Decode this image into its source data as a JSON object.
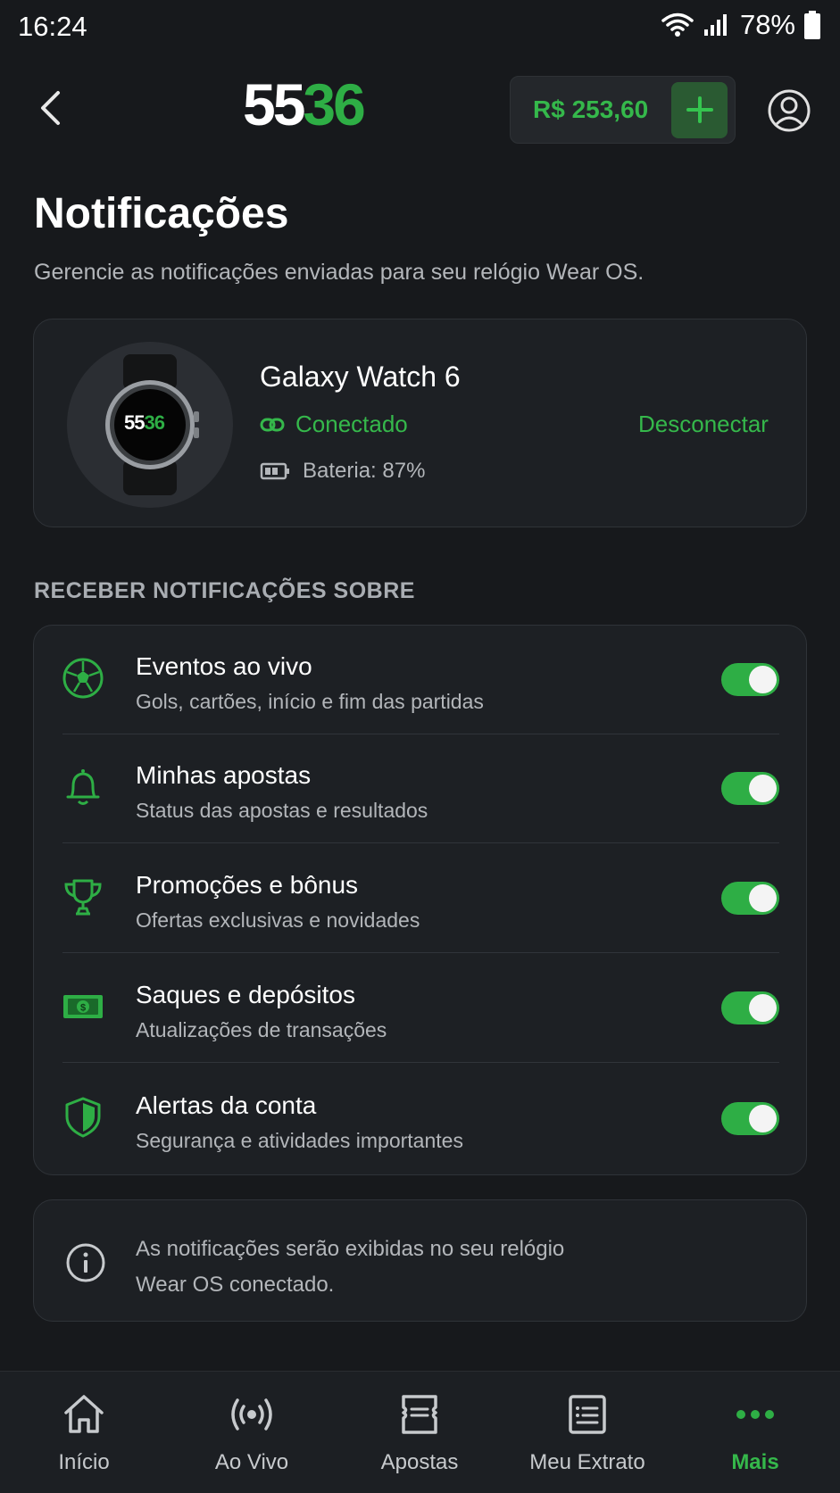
{
  "status_bar": {
    "time": "16:24",
    "battery_pct": "78%"
  },
  "header": {
    "logo_white": "55",
    "logo_green": "36",
    "balance": "R$ 253,60"
  },
  "page": {
    "title": "Notificações",
    "subtitle": "Gerencie as notificações enviadas para seu relógio Wear OS."
  },
  "device": {
    "watch_logo_white": "55",
    "watch_logo_green": "36",
    "name": "Galaxy Watch 6",
    "status": "Conectado",
    "disconnect_label": "Desconectar",
    "battery": "Bateria: 87%"
  },
  "section_label": "RECEBER NOTIFICAÇÕES SOBRE",
  "notifications": [
    {
      "title": "Eventos ao vivo",
      "subtitle": "Gols, cartões, início e fim das partidas",
      "icon": "soccer-ball-icon",
      "enabled": true
    },
    {
      "title": "Minhas apostas",
      "subtitle": "Status das apostas e resultados",
      "icon": "bell-icon",
      "enabled": true
    },
    {
      "title": "Promoções e bônus",
      "subtitle": "Ofertas exclusivas e novidades",
      "icon": "trophy-icon",
      "enabled": true
    },
    {
      "title": "Saques e depósitos",
      "subtitle": "Atualizações de transações",
      "icon": "money-icon",
      "enabled": true
    },
    {
      "title": "Alertas da conta",
      "subtitle": "Segurança e atividades importantes",
      "icon": "shield-icon",
      "enabled": true
    }
  ],
  "info": {
    "line1": "As notificações serão exibidas no seu relógio",
    "line2": "Wear OS conectado."
  },
  "bottom_nav": [
    {
      "label": "Início",
      "icon": "home-icon"
    },
    {
      "label": "Ao Vivo",
      "icon": "live-icon"
    },
    {
      "label": "Apostas",
      "icon": "ticket-icon"
    },
    {
      "label": "Meu Extrato",
      "icon": "statement-icon"
    },
    {
      "label": "Mais",
      "icon": "more-icon",
      "active": true
    }
  ],
  "colors": {
    "accent": "#2eae45",
    "background": "#17191c",
    "card": "#1d2024"
  }
}
